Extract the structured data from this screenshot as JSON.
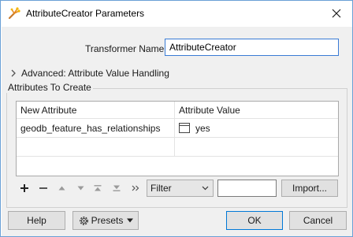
{
  "window": {
    "title": "AttributeCreator Parameters"
  },
  "transformer": {
    "name_label": "Transformer Name:",
    "name_value": "AttributeCreator"
  },
  "advanced": {
    "label": "Advanced: Attribute Value Handling"
  },
  "attributes_group": {
    "label": "Attributes To Create",
    "columns": [
      "New Attribute",
      "Attribute Value"
    ],
    "rows": [
      {
        "attribute": "geodb_feature_has_relationships",
        "value": "yes"
      }
    ]
  },
  "toolbar": {
    "filter_selected": "Filter",
    "filter_text": "",
    "import_label": "Import..."
  },
  "footer": {
    "help_label": "Help",
    "presets_label": "Presets",
    "ok_label": "OK",
    "cancel_label": "Cancel"
  },
  "colors": {
    "window_border": "#6aa0d6",
    "dialog_background": "#f0f0f0",
    "focus_blue": "#0078d7"
  }
}
